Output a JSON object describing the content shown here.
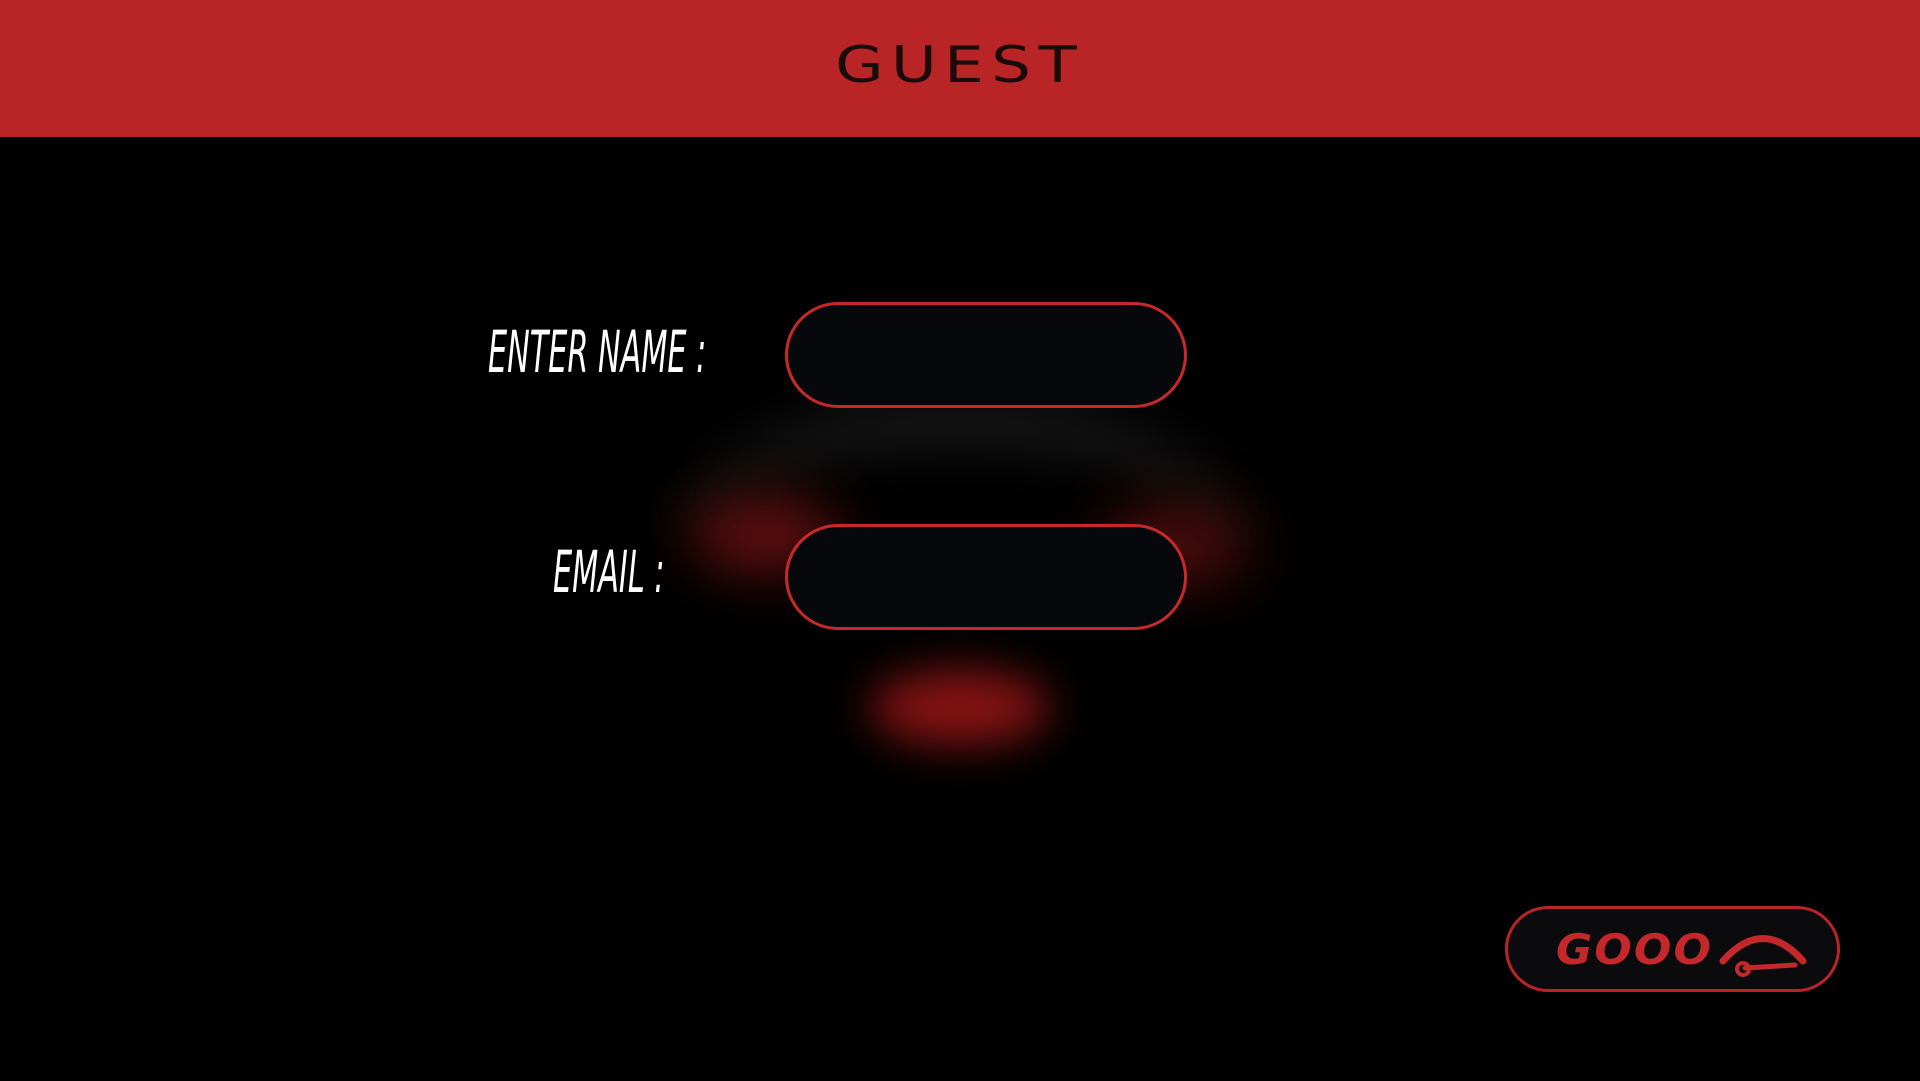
{
  "header": {
    "title": "GUEST"
  },
  "form": {
    "name_label": "ENTER NAME :",
    "name_value": "",
    "email_label": "EMAIL :",
    "email_value": ""
  },
  "submit": {
    "label": "GOOO",
    "icon": "speedometer-icon"
  },
  "colors": {
    "accent": "#b92426",
    "background": "#000000",
    "label_text": "#ffffff",
    "header_text": "#1a0b0b"
  }
}
